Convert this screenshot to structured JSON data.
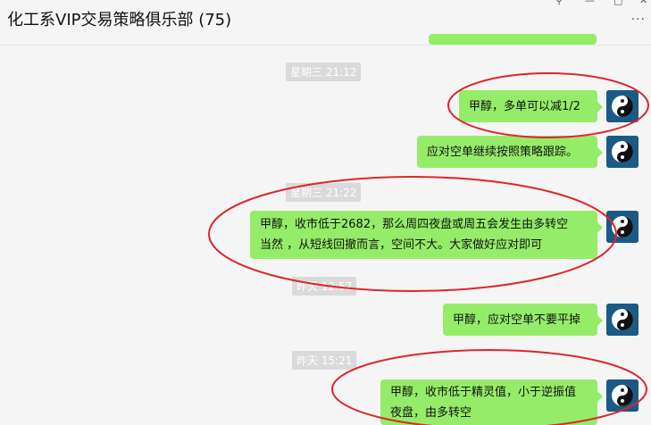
{
  "window": {
    "title": "化工系VIP交易策略俱乐部 (75)",
    "controls": {
      "pin": "⚲",
      "minimize": "—",
      "maximize": "□",
      "close": "✕"
    },
    "more": "···"
  },
  "messages": [
    {
      "type": "time",
      "text": "星期三 21:12"
    },
    {
      "type": "msg",
      "lines": [
        "甲醇，多单可以减1/2"
      ]
    },
    {
      "type": "msg",
      "lines": [
        "应对空单继续按照策略跟踪。"
      ]
    },
    {
      "type": "time",
      "text": "星期三 21:22"
    },
    {
      "type": "msg",
      "lines": [
        "甲醇，收市低于2682，那么周四夜盘或周五会发生由多转空",
        "当然 ，从短线回撤而言，空间不大。大家做好应对即可"
      ]
    },
    {
      "type": "time",
      "text": "昨天 12:57"
    },
    {
      "type": "msg",
      "lines": [
        "甲醇，应对空单不要平掉"
      ]
    },
    {
      "type": "time",
      "text": "昨天 15:21"
    },
    {
      "type": "msg",
      "lines": [
        "甲醇，收市低于精灵值，小于逆振值",
        "夜盘，由多转空"
      ]
    }
  ],
  "colors": {
    "bubble": "#95ec69",
    "annotation": "#e0252b",
    "timestamp_bg": "#dadada",
    "background": "#f5f5f5"
  }
}
